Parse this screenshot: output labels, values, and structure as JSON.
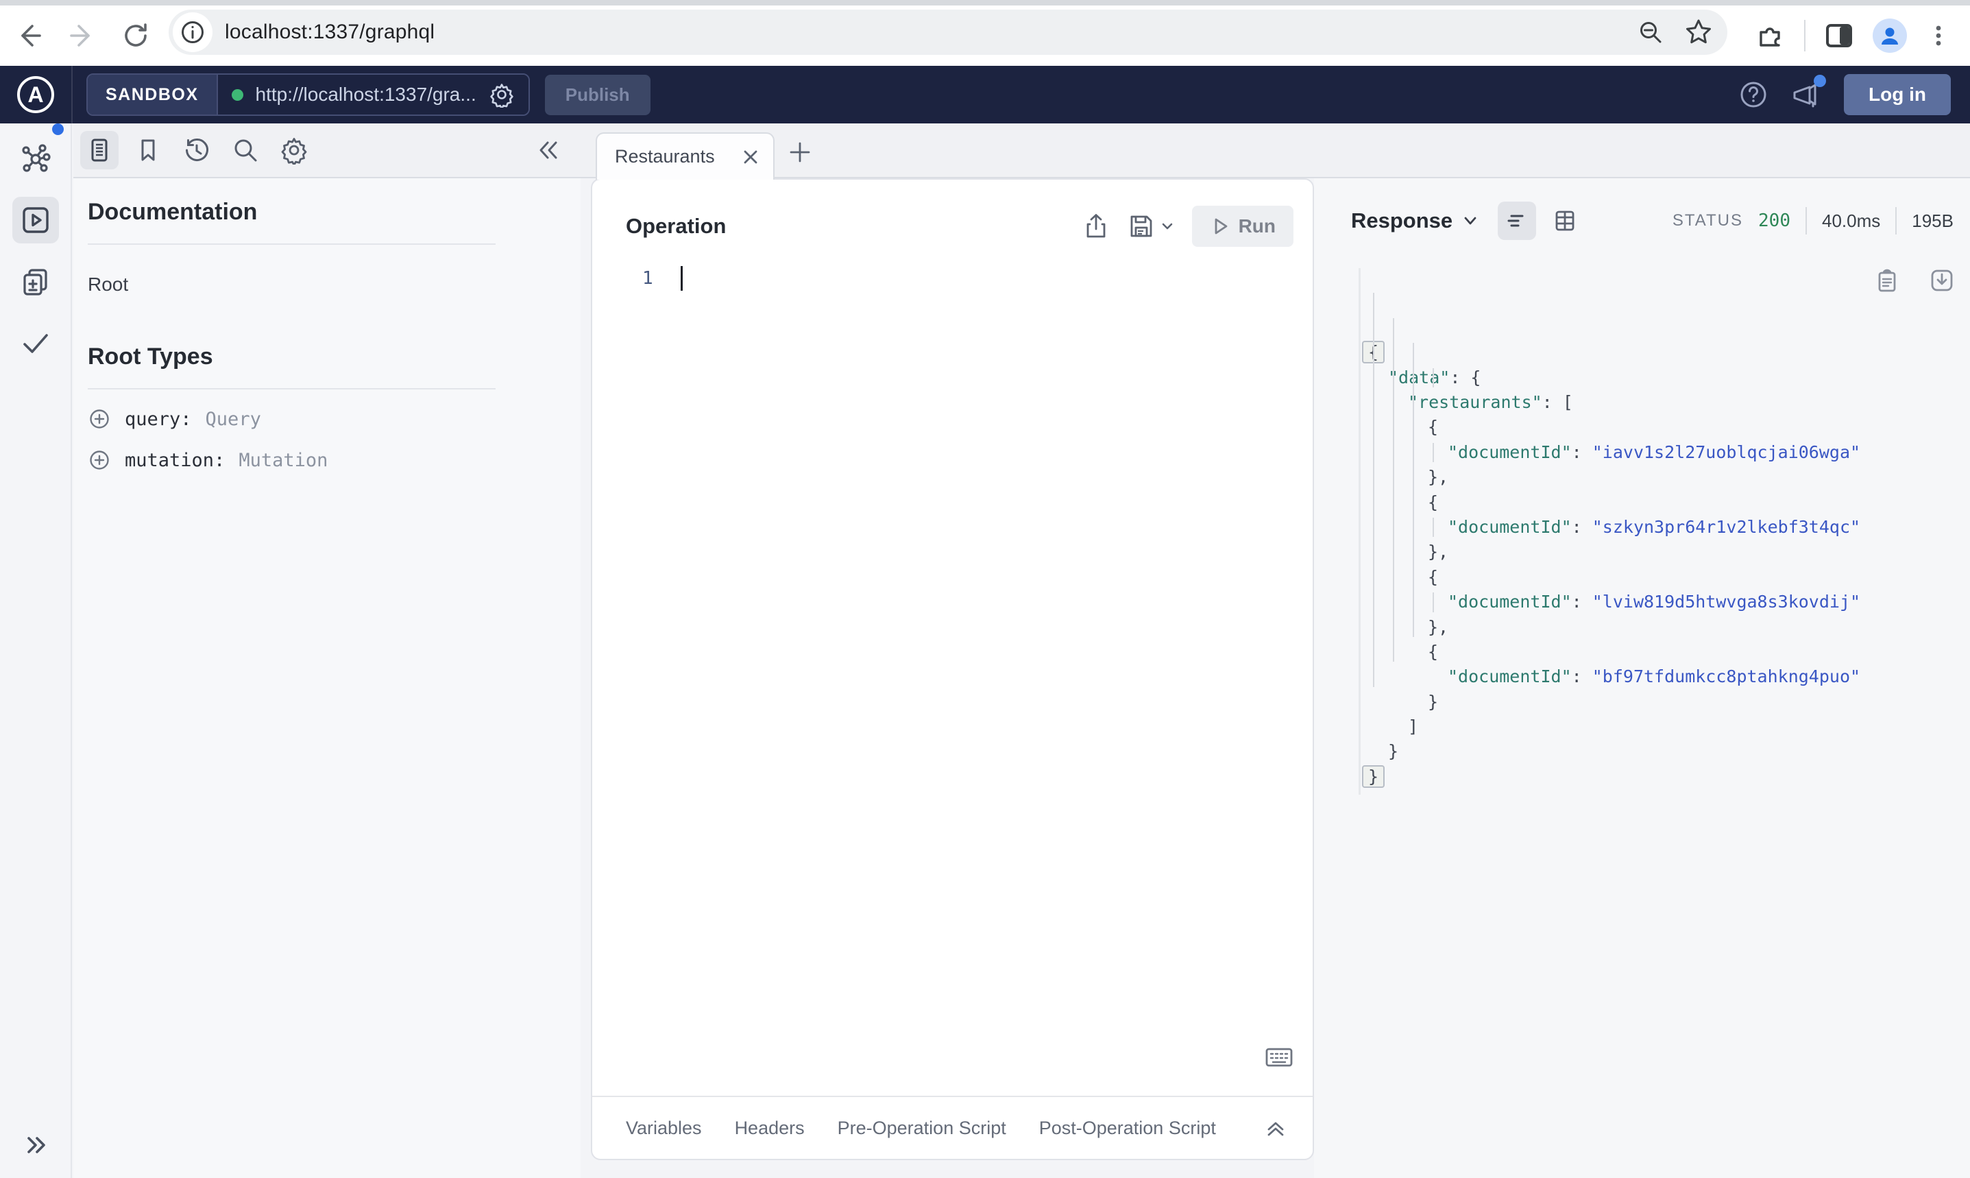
{
  "browser": {
    "url": "localhost:1337/graphql"
  },
  "appbar": {
    "logo_letter": "A",
    "env_label": "SANDBOX",
    "endpoint": "http://localhost:1337/gra...",
    "publish_label": "Publish",
    "login_label": "Log in"
  },
  "docs": {
    "title": "Documentation",
    "root_label": "Root",
    "root_types_title": "Root Types",
    "fields": [
      {
        "name": "query:",
        "type": "Query"
      },
      {
        "name": "mutation:",
        "type": "Mutation"
      }
    ]
  },
  "editor_tab": {
    "title": "Restaurants"
  },
  "operation": {
    "title": "Operation",
    "run_label": "Run",
    "line_number": "1"
  },
  "footer_tabs": [
    "Variables",
    "Headers",
    "Pre-Operation Script",
    "Post-Operation Script"
  ],
  "response": {
    "title": "Response",
    "status_label": "STATUS",
    "status_code": "200",
    "duration": "40.0ms",
    "size": "195B",
    "json_lines": [
      {
        "indent": 0,
        "punct": "{",
        "fold": true
      },
      {
        "indent": 1,
        "key": "\"data\"",
        "punct": ": {"
      },
      {
        "indent": 2,
        "key": "\"restaurants\"",
        "punct": ": ["
      },
      {
        "indent": 3,
        "punct": "{"
      },
      {
        "indent": 4,
        "key": "\"documentId\"",
        "colon": ": ",
        "value": "\"iavv1s2l27uoblqcjai06wga\""
      },
      {
        "indent": 3,
        "punct": "},"
      },
      {
        "indent": 3,
        "punct": "{"
      },
      {
        "indent": 4,
        "key": "\"documentId\"",
        "colon": ": ",
        "value": "\"szkyn3pr64r1v2lkebf3t4qc\""
      },
      {
        "indent": 3,
        "punct": "},"
      },
      {
        "indent": 3,
        "punct": "{"
      },
      {
        "indent": 4,
        "key": "\"documentId\"",
        "colon": ": ",
        "value": "\"lviw819d5htwvga8s3kovdij\""
      },
      {
        "indent": 3,
        "punct": "},"
      },
      {
        "indent": 3,
        "punct": "{"
      },
      {
        "indent": 4,
        "key": "\"documentId\"",
        "colon": ": ",
        "value": "\"bf97tfdumkcc8ptahkng4puo\""
      },
      {
        "indent": 3,
        "punct": "}"
      },
      {
        "indent": 2,
        "punct": "]"
      },
      {
        "indent": 1,
        "punct": "}"
      },
      {
        "indent": 0,
        "punct": "}",
        "fold": true
      }
    ]
  },
  "colors": {
    "status_ok": "#2e8757",
    "json_key": "#2d7a6e",
    "json_value": "#3a57c4",
    "accent_blue": "#2f6fe4",
    "appbar_bg": "#1c2340"
  },
  "icons": {
    "rail": [
      "schema-graph",
      "operations-play",
      "changelog-docs",
      "checks"
    ],
    "doc_toolbar": [
      "documentation",
      "bookmark",
      "history",
      "search",
      "settings"
    ]
  }
}
